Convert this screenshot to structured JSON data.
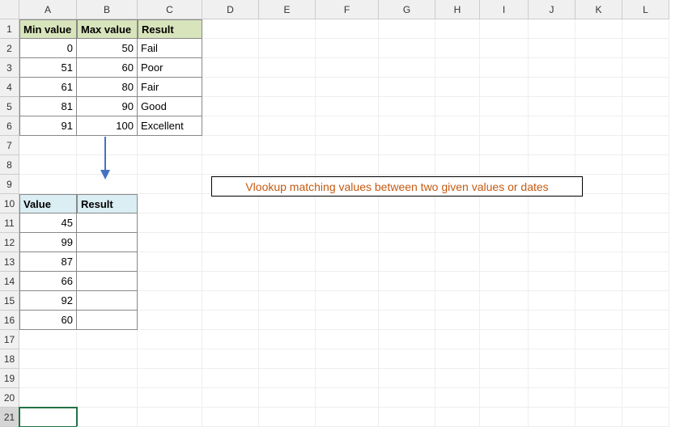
{
  "columns": [
    "A",
    "B",
    "C",
    "D",
    "E",
    "F",
    "G",
    "H",
    "I",
    "J",
    "K",
    "L"
  ],
  "rows": [
    "1",
    "2",
    "3",
    "4",
    "5",
    "6",
    "7",
    "8",
    "9",
    "10",
    "11",
    "12",
    "13",
    "14",
    "15",
    "16",
    "17",
    "18",
    "19",
    "20",
    "21"
  ],
  "table1": {
    "headers": {
      "min": "Min value",
      "max": "Max value",
      "result": "Result"
    },
    "data": [
      {
        "min": "0",
        "max": "50",
        "result": "Fail"
      },
      {
        "min": "51",
        "max": "60",
        "result": "Poor"
      },
      {
        "min": "61",
        "max": "80",
        "result": "Fair"
      },
      {
        "min": "81",
        "max": "90",
        "result": "Good"
      },
      {
        "min": "91",
        "max": "100",
        "result": "Excellent"
      }
    ]
  },
  "table2": {
    "headers": {
      "value": "Value",
      "result": "Result"
    },
    "data": [
      {
        "value": "45",
        "result": ""
      },
      {
        "value": "99",
        "result": ""
      },
      {
        "value": "87",
        "result": ""
      },
      {
        "value": "66",
        "result": ""
      },
      {
        "value": "92",
        "result": ""
      },
      {
        "value": "60",
        "result": ""
      }
    ]
  },
  "callout": "Vlookup matching values between two given values or dates",
  "selected_row": "21"
}
